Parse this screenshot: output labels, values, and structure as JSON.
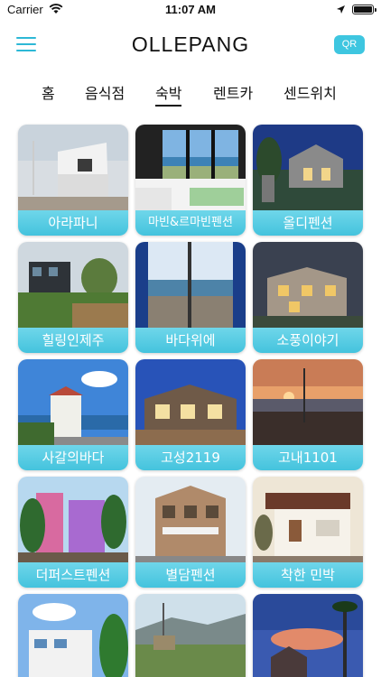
{
  "status_bar": {
    "carrier": "Carrier",
    "time": "11:07 AM",
    "battery_level": 1.0
  },
  "header": {
    "title": "OLLEPANG",
    "qr_label": "QR"
  },
  "tabs": [
    {
      "label": "홈",
      "active": false
    },
    {
      "label": "음식점",
      "active": false
    },
    {
      "label": "숙박",
      "active": true
    },
    {
      "label": "렌트카",
      "active": false
    },
    {
      "label": "센드위치",
      "active": false
    }
  ],
  "listings": [
    {
      "name": "아라파니"
    },
    {
      "name": "마빈&르마빈펜션"
    },
    {
      "name": "올디펜션"
    },
    {
      "name": "힐링인제주"
    },
    {
      "name": "바다위에"
    },
    {
      "name": "소풍이야기"
    },
    {
      "name": "사갈의바다"
    },
    {
      "name": "고성2119"
    },
    {
      "name": "고내1101"
    },
    {
      "name": "더퍼스트펜션"
    },
    {
      "name": "별담펜션"
    },
    {
      "name": "착한 민박"
    },
    {
      "name": ""
    },
    {
      "name": ""
    },
    {
      "name": ""
    }
  ],
  "colors": {
    "accent": "#3ec6e0",
    "label_band": "#4fc8e0"
  }
}
